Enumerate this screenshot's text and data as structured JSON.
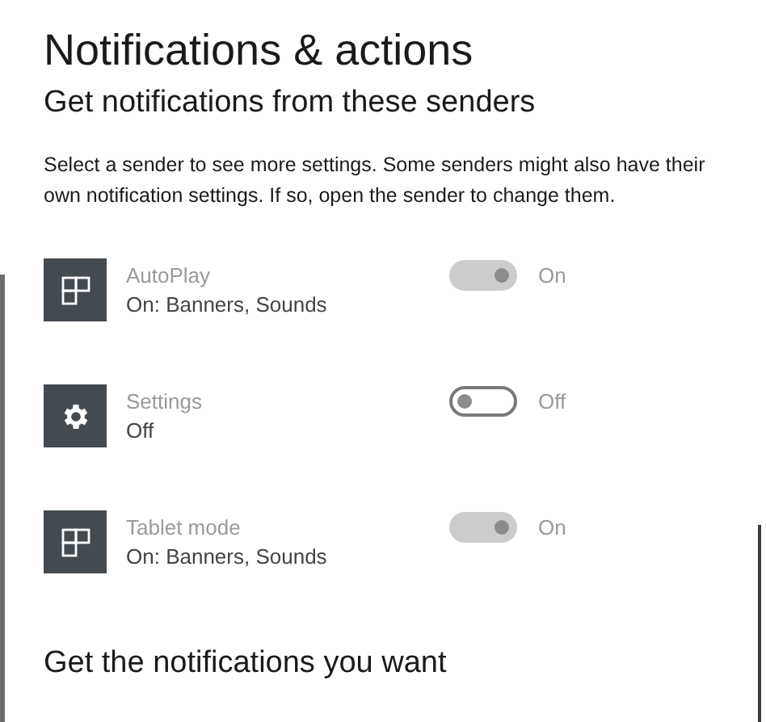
{
  "title": "Notifications & actions",
  "section_heading": "Get notifications from these senders",
  "description": "Select a sender to see more settings. Some senders might also have their own notification settings. If so, open the sender to change them.",
  "senders": [
    {
      "kind": "tiles",
      "name": "AutoPlay",
      "status": "On: Banners, Sounds",
      "on": true,
      "toggle_label": "On"
    },
    {
      "kind": "gear",
      "name": "Settings",
      "status": "Off",
      "on": false,
      "toggle_label": "Off"
    },
    {
      "kind": "tiles",
      "name": "Tablet mode",
      "status": "On: Banners, Sounds",
      "on": true,
      "toggle_label": "On"
    }
  ],
  "next_heading": "Get the notifications you want"
}
